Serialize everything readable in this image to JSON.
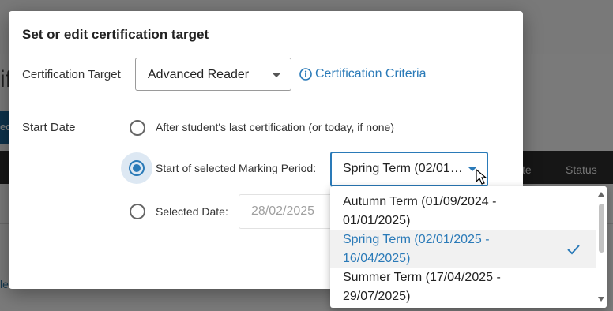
{
  "background": {
    "page_title_fragment": "if",
    "button_fragment": "ed",
    "table_headers": [
      "te",
      "Status"
    ],
    "link_fragment": "le"
  },
  "modal": {
    "title": "Set or edit certification target",
    "certification_target": {
      "label": "Certification Target",
      "value": "Advanced Reader",
      "criteria_link": "Certification Criteria"
    },
    "start_date": {
      "label": "Start Date",
      "options": [
        {
          "label": "After student's last certification (or today, if none)",
          "checked": false
        },
        {
          "label": "Start of selected Marking Period:",
          "checked": true
        },
        {
          "label": "Selected Date:",
          "checked": false
        }
      ],
      "marking_period_value": "Spring Term (02/01…",
      "selected_date_placeholder": "28/02/2025"
    }
  },
  "dropdown": {
    "options": [
      {
        "line1": "Autumn Term (01/09/2024 -",
        "line2": "01/01/2025)",
        "selected": false
      },
      {
        "line1": "Spring Term (02/01/2025 -",
        "line2": "16/04/2025)",
        "selected": true
      },
      {
        "line1": "Summer Term (17/04/2025 -",
        "line2": "29/07/2025)",
        "selected": false
      }
    ]
  },
  "colors": {
    "accent": "#2a7ab8",
    "overlay": "rgba(0,0,0,0.47)",
    "table_header": "#2b2b2b"
  },
  "icons": {
    "info": "info-circle-icon",
    "caret": "caret-down-icon",
    "check": "check-icon",
    "cursor": "mouse-pointer-icon"
  }
}
